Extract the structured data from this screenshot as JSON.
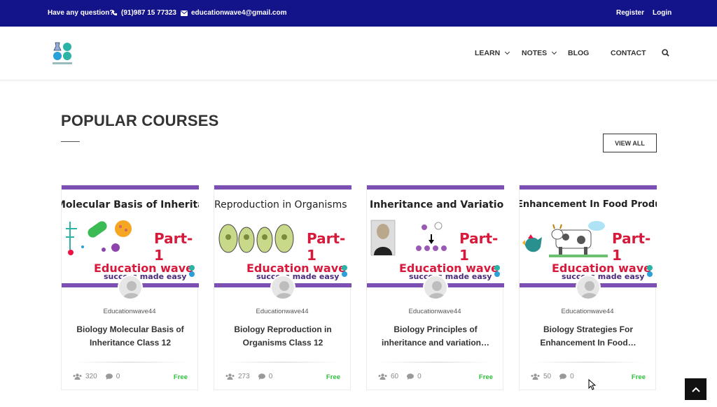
{
  "topbar": {
    "question": "Have any question?",
    "phone": "(91)987 15 77323",
    "email": "educationwave4@gmail.com",
    "register": "Register",
    "login": "Login"
  },
  "nav": {
    "learn": "LEARN",
    "notes": "NOTES",
    "blog": "BLOG",
    "contact": "CONTACT"
  },
  "section": {
    "title": "POPULAR COURSES",
    "view_all": "VIEW ALL"
  },
  "courses": [
    {
      "thumb_title": "Molecular Basis of Inheritance",
      "part": "Part-1",
      "brand": "Education wave",
      "tagline": "success made easy",
      "author": "Educationwave44",
      "title": "Biology Molecular Basis of Inheritance Class 12",
      "students": "320",
      "comments": "0",
      "price": "Free"
    },
    {
      "thumb_title": "Reproduction in Organisms",
      "part": "Part-1",
      "brand": "Education wave",
      "tagline": "success made easy",
      "author": "Educationwave44",
      "title": "Biology Reproduction in Organisms Class 12",
      "students": "273",
      "comments": "0",
      "price": "Free"
    },
    {
      "thumb_title": "Inheritance and Variation",
      "part": "Part-1",
      "brand": "Education wave",
      "tagline": "success made easy",
      "author": "Educationwave44",
      "title": "Biology Principles of inheritance and variation…",
      "students": "60",
      "comments": "0",
      "price": "Free"
    },
    {
      "thumb_title": "Enhancement In Food Production",
      "part": "Part-1",
      "brand": "Education wave",
      "tagline": "success made easy",
      "author": "Educationwave44",
      "title": "Biology Strategies For Enhancement In Food…",
      "students": "50",
      "comments": "0",
      "price": "Free"
    }
  ],
  "colors": {
    "topbar": "#14148a",
    "thumb_border": "#7c4fb3",
    "part_red": "#d7193b",
    "free_green": "#2bbf3a"
  }
}
